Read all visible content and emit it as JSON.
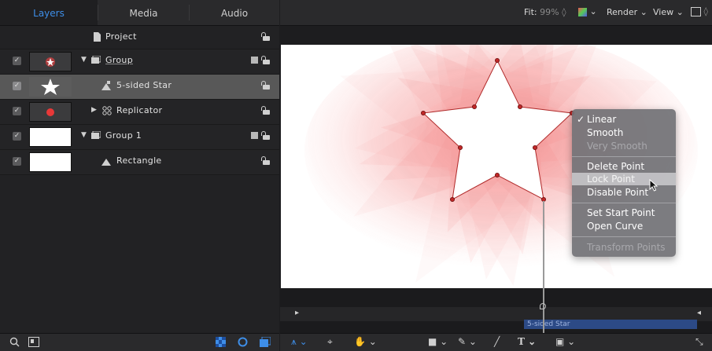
{
  "tabs": [
    "Layers",
    "Media",
    "Audio"
  ],
  "layers": [
    {
      "name": "Project"
    },
    {
      "name": "Group"
    },
    {
      "name": "5-sided Star"
    },
    {
      "name": "Replicator"
    },
    {
      "name": "Group 1"
    },
    {
      "name": "Rectangle"
    }
  ],
  "topbar": {
    "fit_label": "Fit:",
    "fit_value": "99%",
    "render": "Render",
    "view": "View"
  },
  "menu": {
    "items": [
      {
        "label": "Linear",
        "checked": true
      },
      {
        "label": "Smooth"
      },
      {
        "label": "Very Smooth",
        "disabled": true
      },
      {
        "label": "Delete Point"
      },
      {
        "label": "Lock Point",
        "highlighted": true
      },
      {
        "label": "Disable Point"
      },
      {
        "label": "Set Start Point"
      },
      {
        "label": "Open Curve"
      },
      {
        "label": "Transform Points",
        "disabled": true
      }
    ]
  },
  "timeline": {
    "clip_label": "5-sided Star"
  },
  "colors": {
    "accent": "#3e8ee8",
    "star_glow": "#f05050",
    "timeline_clip": "#2c4a86"
  }
}
